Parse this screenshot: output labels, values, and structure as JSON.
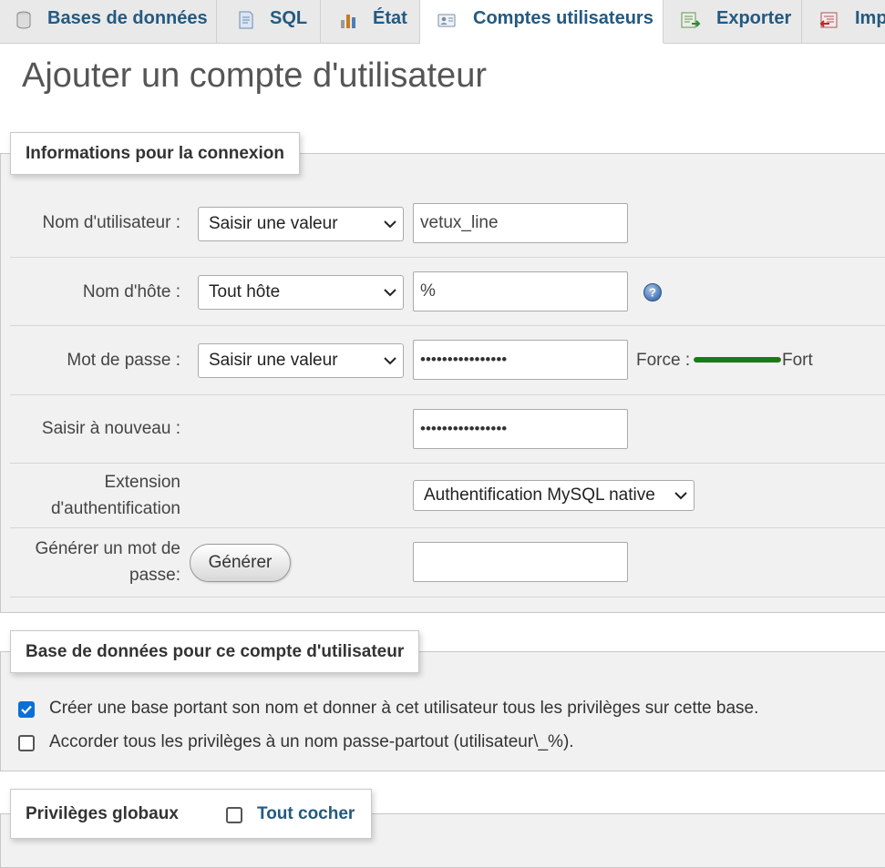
{
  "tabs": [
    {
      "label": "Bases de données",
      "icon": "database-icon",
      "active": false
    },
    {
      "label": "SQL",
      "icon": "sql-icon",
      "active": false
    },
    {
      "label": "État",
      "icon": "status-icon",
      "active": false
    },
    {
      "label": "Comptes utilisateurs",
      "icon": "user-accounts-icon",
      "active": true
    },
    {
      "label": "Exporter",
      "icon": "export-icon",
      "active": false
    },
    {
      "label": "Imp",
      "icon": "import-icon",
      "active": false
    }
  ],
  "page": {
    "title": "Ajouter un compte d'utilisateur"
  },
  "login_info": {
    "legend": "Informations pour la connexion",
    "username": {
      "label": "Nom d'utilisateur :",
      "select": "Saisir une valeur",
      "value": "vetux_line"
    },
    "hostname": {
      "label": "Nom d'hôte :",
      "select": "Tout hôte",
      "value": "%",
      "help_icon": "help-icon"
    },
    "password": {
      "label": "Mot de passe :",
      "select": "Saisir une valeur",
      "value": "••••••••••••••••",
      "strength_label": "Force :",
      "strength_text": "Fort",
      "strength_color": "#1a7a1a",
      "strength_level": 1.0
    },
    "retype": {
      "label": "Saisir à nouveau :",
      "value": "••••••••••••••••"
    },
    "auth_plugin": {
      "label_line1": "Extension",
      "label_line2": "d'authentification",
      "select": "Authentification MySQL native"
    },
    "generate": {
      "label_line1": "Générer un mot de",
      "label_line2": "passe:",
      "button": "Générer",
      "value": ""
    }
  },
  "database": {
    "legend": "Base de données pour ce compte d'utilisateur",
    "options": [
      {
        "label": "Créer une base portant son nom et donner à cet utilisateur tous les privilèges sur cette base.",
        "checked": true
      },
      {
        "label": "Accorder tous les privilèges à un nom passe-partout (utilisateur\\_%).",
        "checked": false
      }
    ]
  },
  "global_privileges": {
    "legend": "Privilèges globaux",
    "check_all_label": "Tout cocher",
    "check_all_checked": false
  },
  "colors": {
    "link": "#235a81",
    "accent": "#0b6fd6",
    "panel": "#f1f1f1"
  }
}
